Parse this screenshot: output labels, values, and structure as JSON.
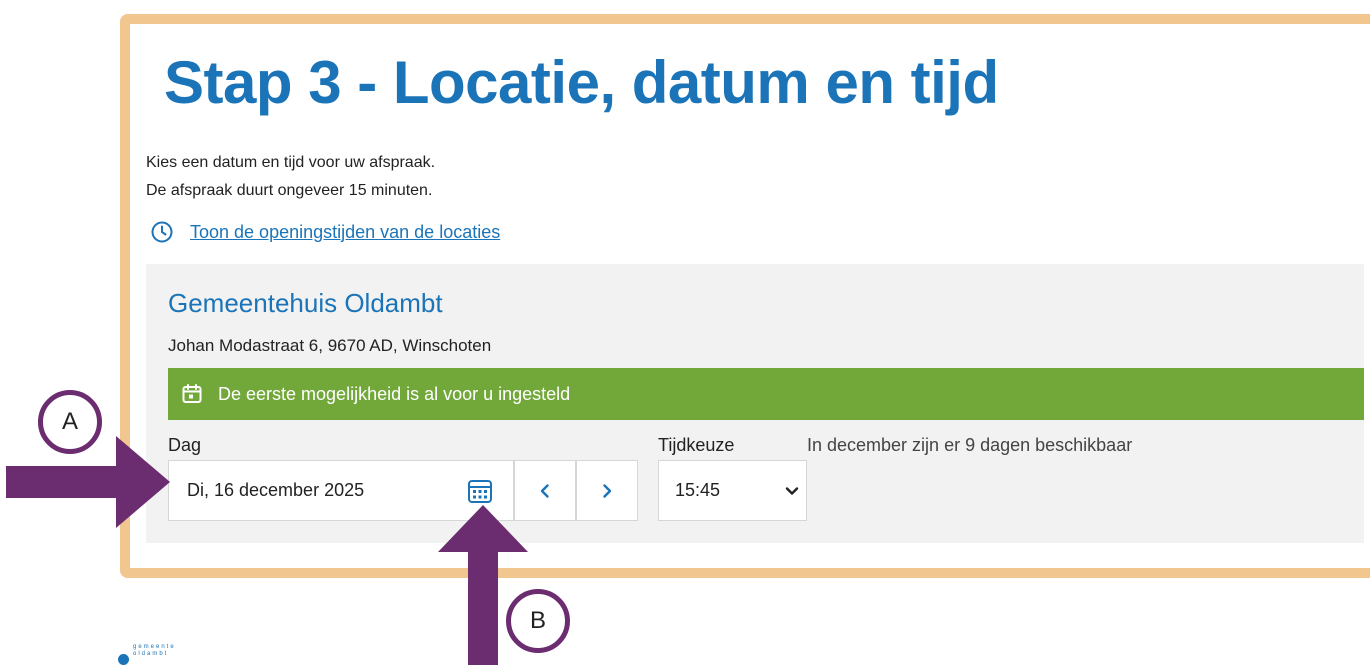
{
  "page": {
    "title": "Stap 3 - Locatie, datum en tijd",
    "intro_line1": "Kies een datum en tijd voor uw afspraak.",
    "intro_line2": "De afspraak duurt ongeveer 15 minuten.",
    "hours_link": "Toon de openingstijden van de locaties"
  },
  "location": {
    "name": "Gemeentehuis Oldambt",
    "address": "Johan Modastraat 6, 9670 AD, Winschoten",
    "banner": "De eerste mogelijkheid is al voor u ingesteld"
  },
  "form": {
    "day_label": "Dag",
    "day_value": "Di, 16 december 2025",
    "time_label": "Tijdkeuze",
    "time_value": "15:45",
    "availability": "In december zijn er 9 dagen beschikbaar"
  },
  "annotations": {
    "a": "A",
    "b": "B",
    "arrow_color": "#6b2c70",
    "frame_color": "#f1c68f"
  },
  "logo": {
    "line1": "gemeente",
    "line2": "oldambt"
  },
  "colors": {
    "primary": "#1b74b8",
    "banner": "#72a83a",
    "panel": "#f2f2f2"
  },
  "icons": {
    "hours": "clock-icon",
    "banner": "calendar-icon",
    "date_picker": "calendar-grid-icon",
    "prev": "chevron-left-icon",
    "next": "chevron-right-icon",
    "select": "chevron-down-icon"
  }
}
